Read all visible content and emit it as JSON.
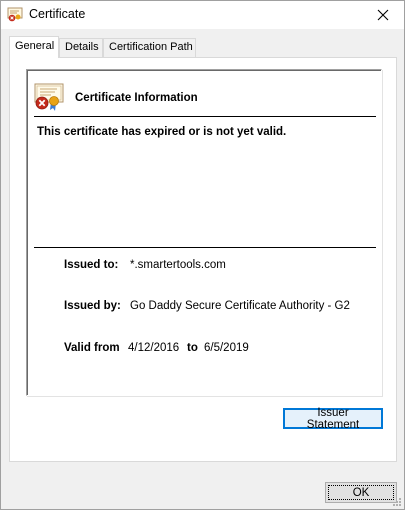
{
  "window": {
    "title": "Certificate",
    "close_glyph": "✕"
  },
  "tabs": [
    {
      "label": "General",
      "active": true
    },
    {
      "label": "Details",
      "active": false
    },
    {
      "label": "Certification Path",
      "active": false
    }
  ],
  "general": {
    "heading": "Certificate Information",
    "message": "This certificate has expired or is not yet valid.",
    "issued_to_label": "Issued to:",
    "issued_to_value": "*.smartertools.com",
    "issued_by_label": "Issued by:",
    "issued_by_value": "Go Daddy Secure Certificate Authority - G2",
    "valid_from_label": "Valid from",
    "valid_from_value": "4/12/2016",
    "valid_to_label": "to",
    "valid_to_value": "6/5/2019",
    "issuer_statement_button": "Issuer Statement"
  },
  "footer": {
    "ok_button": "OK"
  },
  "icons": {
    "title": "certificate-icon",
    "cert": "certificate-error-icon",
    "close": "close-icon"
  },
  "colors": {
    "focus": "#0078d7",
    "error": "#c42b1c",
    "seal": "#e8a317"
  }
}
